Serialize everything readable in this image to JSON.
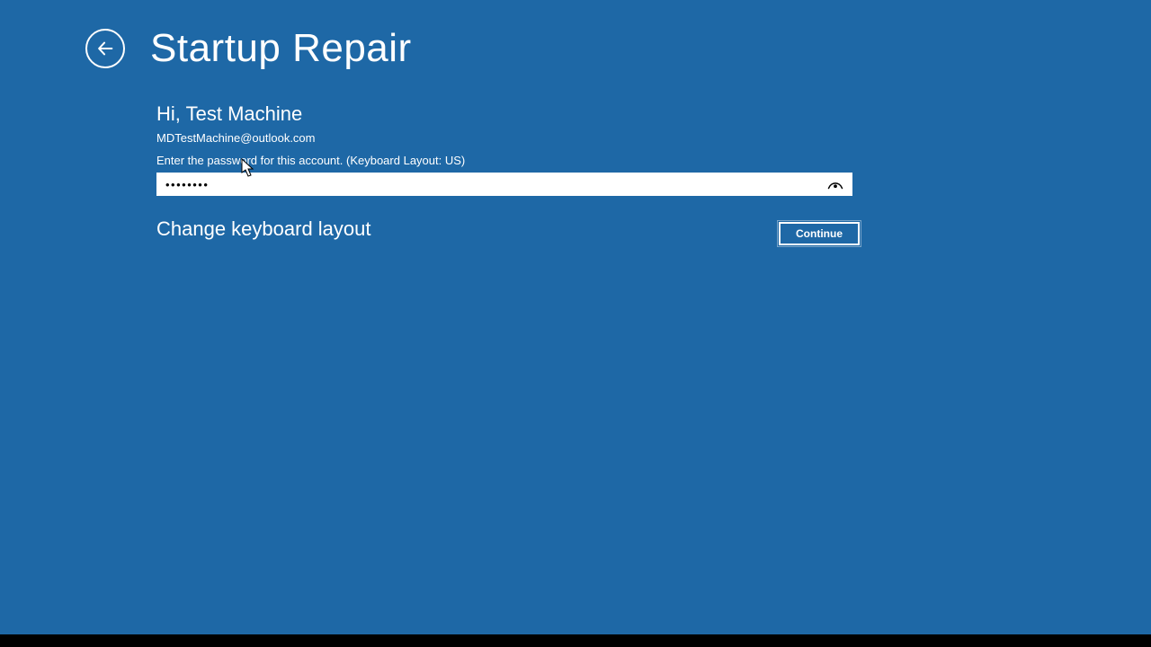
{
  "header": {
    "title": "Startup Repair"
  },
  "account": {
    "greeting": "Hi, Test Machine",
    "email": "MDTestMachine@outlook.com",
    "instruction": "Enter the password for this account. (Keyboard Layout: US)",
    "password_value": "••••••••"
  },
  "actions": {
    "change_layout": "Change keyboard layout",
    "continue_label": "Continue"
  }
}
